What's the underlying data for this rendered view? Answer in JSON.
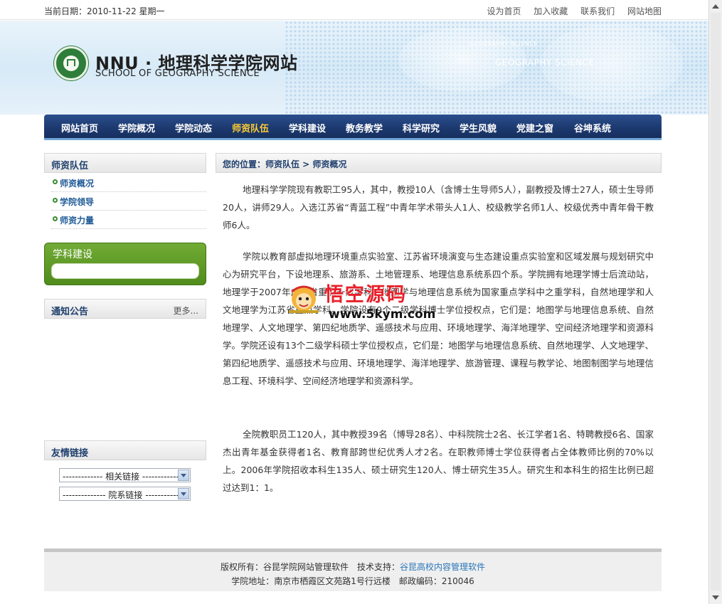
{
  "topbar": {
    "date": "当前日期：2010-11-22 星期一",
    "links": [
      "设为首页",
      "加入收藏",
      "联系我们",
      "网站地图"
    ]
  },
  "header": {
    "title": "NNU · 地理科学学院网站",
    "subtitle": "SCHOOL OF GEOGRAPHY SCIENCE",
    "banner_small": "GEOGRAPHY SCIENCE",
    "banner_big": "GEOGRAPHY SCIENCE"
  },
  "nav": {
    "items": [
      "网站首页",
      "学院概况",
      "学院动态",
      "师资队伍",
      "学科建设",
      "教务教学",
      "科学研究",
      "学生风貌",
      "党建之窗",
      "谷坤系统"
    ],
    "active": "师资队伍"
  },
  "sidebar": {
    "section_title": "师资队伍",
    "items": [
      "师资概况",
      "学院领导",
      "师资力量"
    ],
    "green_box_title": "学科建设",
    "notice_title": "通知公告",
    "notice_more": "更多...",
    "friend_links_title": "友情链接",
    "selects": [
      "------------- 相关链接 -------------",
      "-------------- 院系链接 -------------"
    ]
  },
  "main": {
    "breadcrumb": "您的位置：师资队伍 > 师资概况",
    "paragraphs": [
      "地理科学学院现有教职工95人，其中，教授10人（含博士生导师5人），副教授及博士27人，硕士生导师20人，讲师29人。入选江苏省“青蓝工程”中青年学术带头人1人、校级教学名师1人、校级优秀中青年骨干教师6人。",
      "学院以教育部虚拟地理环境重点实验室、江苏省环境演变与生态建设重点实验室和区域发展与规划研究中心为研究平台，下设地理系、旅游系、土地管理系、地理信息系统系四个系。学院拥有地理学博士后流动站，地理学于2007年成为省重点一级学科。地图学与地理信息系统为国家重点学科中之重学科，自然地理学和人文地理学为江苏省重点学科。学院设有9个二级学科博士学位授权点，它们是：地图学与地理信息系统、自然地理学、人文地理学、第四纪地质学、遥感技术与应用、环境地理学、海洋地理学、空间经济地理学和资源科学。学院还设有13个二级学科硕士学位授权点，它们是：地图学与地理信息系统、自然地理学、人文地理学、第四纪地质学、遥感技术与应用、环境地理学、海洋地理学、旅游管理、课程与教学论、地图制图学与地理信息工程、环境科学、空间经济地理学和资源科学。",
      "全院教职员工120人，其中教授39名（博导28名）、中科院院士2名、长江学者1名、特聘教授6名、国家杰出青年基金获得者1名、教育部跨世纪优秀人才2名。在职教师博士学位获得者占全体教师比例的70%以上。2006年学院招收本科生135人、硕士研究生120人、博士研究生35人。研究生和本科生的招生比例已超过达到1：1。"
    ]
  },
  "watermark": {
    "brand": "悟空源码",
    "url": "www.5kym.com"
  },
  "footer": {
    "line1_prefix": "版权所有：谷昆学院网站管理软件　技术支持：",
    "line1_link": "谷昆高校内容管理软件",
    "line2": "学院地址：南京市栖霞区文苑路1号行远楼　邮政编码：210046"
  },
  "colors": {
    "nav_bg": "#1d3a70",
    "nav_active": "#ffcc33",
    "green_box": "#5f9b27",
    "link_blue": "#2a76b8",
    "watermark_red": "#e8202a"
  }
}
